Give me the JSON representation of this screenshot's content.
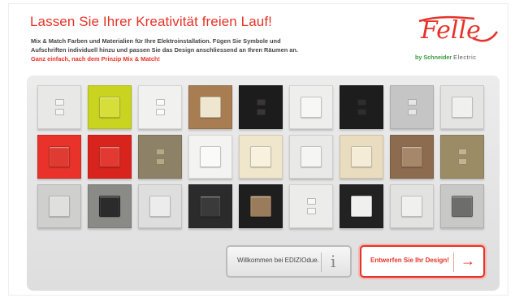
{
  "header": {
    "title": "Lassen Sie Ihrer Kreativität freien Lauf!",
    "intro_line1": "Mix & Match Farben und Materialien für Ihre Elektroinstallation. Fügen Sie Symbole und",
    "intro_line2": "Aufschriften individuell hinzu und passen Sie das Design anschliessend an Ihren Räumen an.",
    "intro_line3": "Ganz einfach, nach dem Prinzip Mix & Match!"
  },
  "logo": {
    "wordmark": "Felle",
    "sub_by": "by Schneider",
    "sub_brand": "Electric"
  },
  "switch_grid": {
    "rows": [
      [
        {
          "name": "switch-white-double",
          "frame": "#e8e8e6",
          "rocker": "#f4f4f2",
          "type": "dual"
        },
        {
          "name": "switch-lime",
          "frame": "#c9d421",
          "rocker": "#d6df3a",
          "type": "single"
        },
        {
          "name": "switch-white-double-2",
          "frame": "#f1f1ef",
          "rocker": "#fbfbf9",
          "type": "dual"
        },
        {
          "name": "switch-wood",
          "frame": "#a87d52",
          "rocker": "#efe6cf",
          "type": "single"
        },
        {
          "name": "switch-black-gloss-double",
          "frame": "#1c1c1c",
          "rocker": "#3a3634",
          "type": "dual"
        },
        {
          "name": "switch-white-single",
          "frame": "#eeeeec",
          "rocker": "#f7f7f5",
          "type": "single"
        },
        {
          "name": "switch-black-double",
          "frame": "#1d1d1d",
          "rocker": "#2e2e2e",
          "type": "dual"
        },
        {
          "name": "switch-chrome-double",
          "frame": "#c5c5c5",
          "rocker": "#e6e6e6",
          "type": "dual"
        },
        {
          "name": "switch-light-grey",
          "frame": "#e4e4e2",
          "rocker": "#f0f0ee",
          "type": "single"
        }
      ],
      [
        {
          "name": "switch-red-white",
          "frame": "#e8322a",
          "rocker": "#e03b33",
          "type": "single"
        },
        {
          "name": "switch-red",
          "frame": "#d9231d",
          "rocker": "#e23a33",
          "type": "single"
        },
        {
          "name": "switch-bronze-double",
          "frame": "#8d8167",
          "rocker": "#b8a985",
          "type": "dual"
        },
        {
          "name": "switch-white-frame",
          "frame": "#f3f3f1",
          "rocker": "#fafaf8",
          "type": "single"
        },
        {
          "name": "switch-cream",
          "frame": "#efe6cc",
          "rocker": "#f7f1de",
          "type": "single"
        },
        {
          "name": "switch-white-plain",
          "frame": "#e9e9e7",
          "rocker": "#f5f5f3",
          "type": "single"
        },
        {
          "name": "switch-beige",
          "frame": "#eadcbf",
          "rocker": "#f5ecd7",
          "type": "single"
        },
        {
          "name": "switch-brown",
          "frame": "#8c6b4e",
          "rocker": "#a7876a",
          "type": "single"
        },
        {
          "name": "switch-khaki-double",
          "frame": "#9b8c66",
          "rocker": "#c2b48e",
          "type": "dual"
        }
      ],
      [
        {
          "name": "switch-grey",
          "frame": "#cfcfcd",
          "rocker": "#dfdfdd",
          "type": "single"
        },
        {
          "name": "switch-granite-black",
          "frame": "#8a8a86",
          "rocker": "#2b2b2b",
          "type": "single"
        },
        {
          "name": "switch-silver",
          "frame": "#dedede",
          "rocker": "#ececec",
          "type": "single"
        },
        {
          "name": "switch-anthracite",
          "frame": "#2b2b2b",
          "rocker": "#3a3a3a",
          "type": "single"
        },
        {
          "name": "switch-black-bronze",
          "frame": "#1e1e1e",
          "rocker": "#9a7b5c",
          "type": "single"
        },
        {
          "name": "switch-white-double-3",
          "frame": "#ececea",
          "rocker": "#f7f7f5",
          "type": "dual"
        },
        {
          "name": "switch-black-white",
          "frame": "#222222",
          "rocker": "#f0f0ee",
          "type": "single"
        },
        {
          "name": "switch-pale-grey",
          "frame": "#e2e2e0",
          "rocker": "#f0f0ee",
          "type": "single"
        },
        {
          "name": "switch-dark-grey",
          "frame": "#c8c8c6",
          "rocker": "#6d6d6b",
          "type": "single"
        }
      ]
    ]
  },
  "buttons": {
    "welcome_label": "Willkommen bei EDIZIOdue.",
    "info_icon": "i",
    "design_label": "Entwerfen Sie Ihr Design!",
    "arrow_icon": "→"
  }
}
